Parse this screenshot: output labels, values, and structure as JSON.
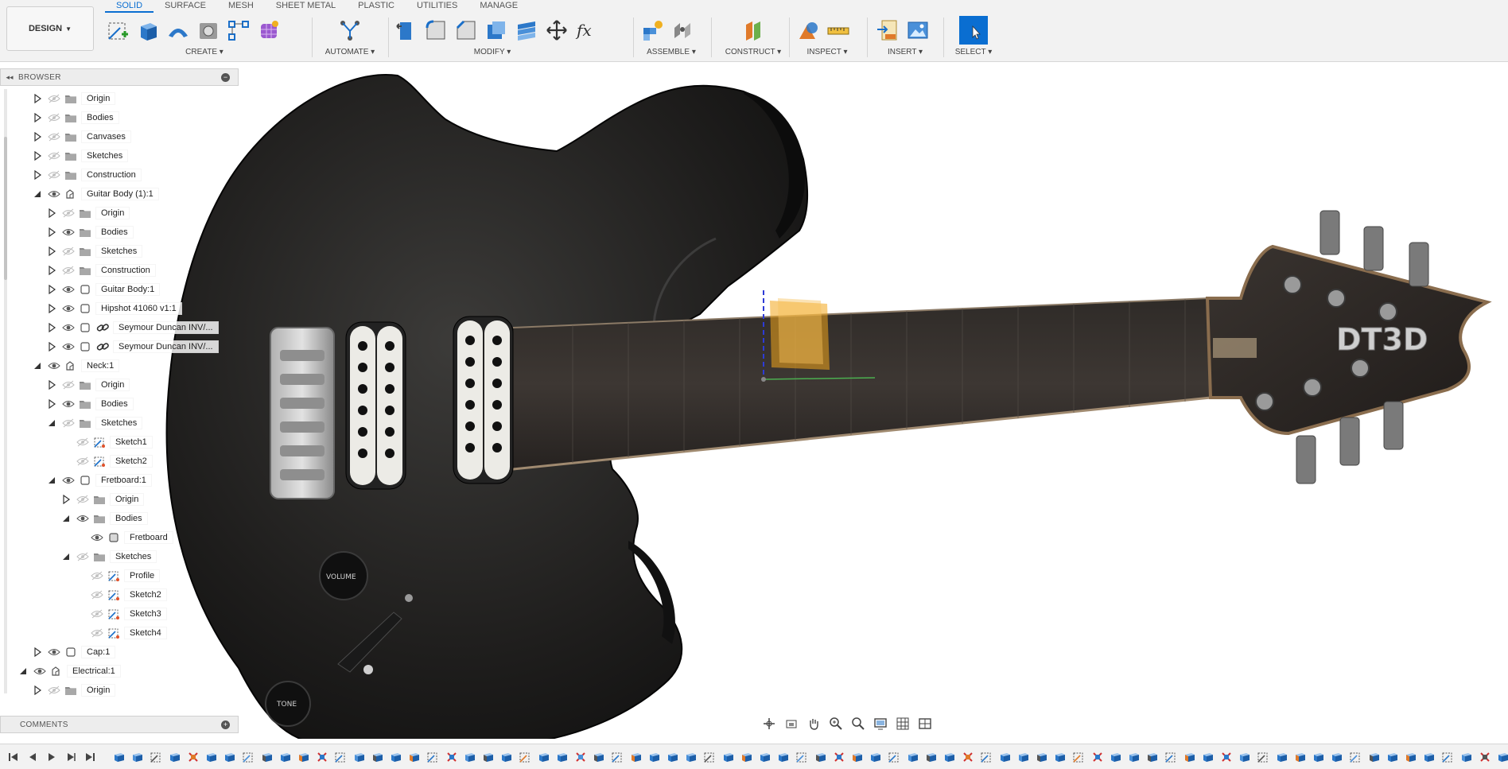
{
  "toolbar": {
    "workspace_label": "DESIGN",
    "tabs": [
      "SOLID",
      "SURFACE",
      "MESH",
      "SHEET METAL",
      "PLASTIC",
      "UTILITIES",
      "MANAGE"
    ],
    "groups": {
      "create": "CREATE",
      "automate": "AUTOMATE",
      "modify": "MODIFY",
      "assemble": "ASSEMBLE",
      "construct": "CONSTRUCT",
      "inspect": "INSPECT",
      "insert": "INSERT",
      "select": "SELECT"
    },
    "accent_color": "#0a6ed1"
  },
  "browser": {
    "title": "BROWSER",
    "items": [
      {
        "label": "Origin",
        "icon": "folder-icon",
        "expand": "collapsed"
      },
      {
        "label": "Bodies",
        "icon": "folder-icon",
        "expand": "collapsed"
      },
      {
        "label": "Canvases",
        "icon": "folder-icon",
        "expand": "collapsed"
      },
      {
        "label": "Sketches",
        "icon": "folder-icon",
        "expand": "collapsed"
      },
      {
        "label": "Construction",
        "icon": "folder-icon",
        "expand": "collapsed"
      },
      {
        "label": "Guitar Body (1):1",
        "icon": "component-icon",
        "expand": "expanded"
      },
      {
        "label": "Origin",
        "icon": "folder-icon",
        "expand": "collapsed"
      },
      {
        "label": "Bodies",
        "icon": "folder-icon",
        "expand": "collapsed"
      },
      {
        "label": "Sketches",
        "icon": "folder-icon",
        "expand": "collapsed"
      },
      {
        "label": "Construction",
        "icon": "folder-icon",
        "expand": "collapsed"
      },
      {
        "label": "Guitar Body:1",
        "icon": "body-icon",
        "expand": "collapsed"
      },
      {
        "label": "Hipshot 41060 v1:1",
        "icon": "body-icon",
        "expand": "collapsed"
      },
      {
        "label": "Seymour Duncan INV/...",
        "icon": "body-icon",
        "expand": "collapsed",
        "linked": true
      },
      {
        "label": "Seymour Duncan INV/...",
        "icon": "body-icon",
        "expand": "collapsed",
        "linked": true
      },
      {
        "label": "Neck:1",
        "icon": "component-icon",
        "expand": "expanded"
      },
      {
        "label": "Origin",
        "icon": "folder-icon",
        "expand": "collapsed"
      },
      {
        "label": "Bodies",
        "icon": "folder-icon",
        "expand": "collapsed"
      },
      {
        "label": "Sketches",
        "icon": "folder-icon",
        "expand": "expanded"
      },
      {
        "label": "Sketch1",
        "icon": "sketch-icon",
        "expand": "none"
      },
      {
        "label": "Sketch2",
        "icon": "sketch-icon",
        "expand": "none"
      },
      {
        "label": "Fretboard:1",
        "icon": "body-icon",
        "expand": "expanded"
      },
      {
        "label": "Origin",
        "icon": "folder-icon",
        "expand": "collapsed"
      },
      {
        "label": "Bodies",
        "icon": "folder-icon",
        "expand": "expanded"
      },
      {
        "label": "Fretboard",
        "icon": "solid-body-icon",
        "expand": "none"
      },
      {
        "label": "Sketches",
        "icon": "folder-icon",
        "expand": "expanded"
      },
      {
        "label": "Profile",
        "icon": "sketch-icon",
        "expand": "none"
      },
      {
        "label": "Sketch2",
        "icon": "sketch-icon",
        "expand": "none"
      },
      {
        "label": "Sketch3",
        "icon": "sketch-icon",
        "expand": "none"
      },
      {
        "label": "Sketch4",
        "icon": "sketch-icon",
        "expand": "none"
      },
      {
        "label": "Cap:1",
        "icon": "body-icon",
        "expand": "collapsed"
      },
      {
        "label": "Electrical:1",
        "icon": "component-icon",
        "expand": "expanded"
      },
      {
        "label": "Origin",
        "icon": "folder-icon",
        "expand": "collapsed"
      }
    ]
  },
  "comments": {
    "title": "COMMENTS"
  },
  "viewport": {
    "knob_volume": "VOLUME",
    "knob_tone": "TONE",
    "headstock_logo": "DT3D"
  }
}
